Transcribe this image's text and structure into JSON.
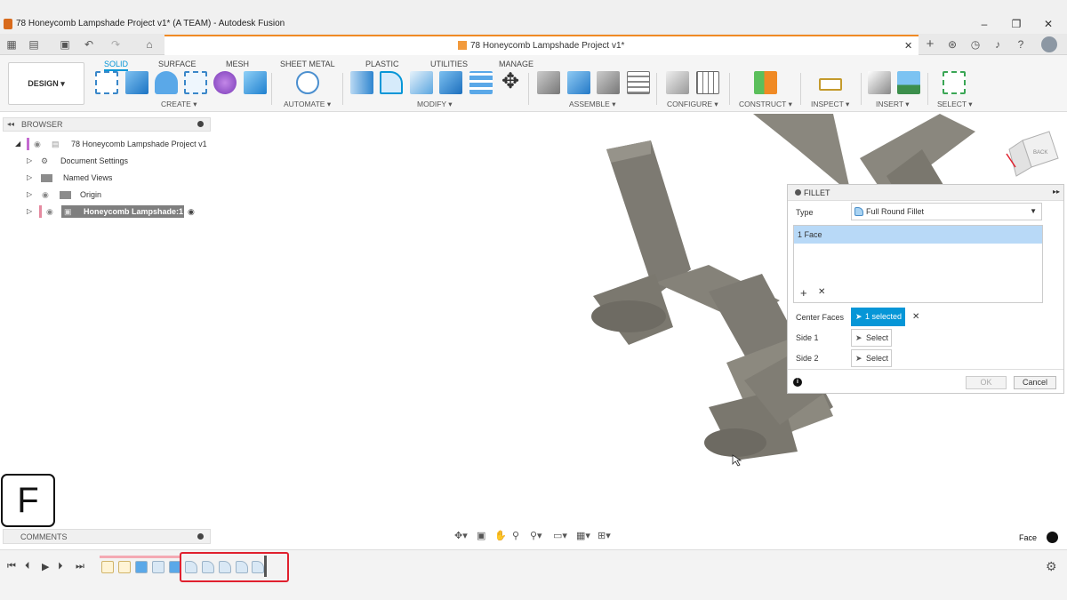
{
  "window": {
    "title": "78 Honeycomb Lampshade Project v1* (A TEAM) - Autodesk Fusion",
    "doc_tab": "78 Honeycomb Lampshade Project v1*"
  },
  "ribbon": {
    "workspace": "DESIGN",
    "tabs": [
      "SOLID",
      "SURFACE",
      "MESH",
      "SHEET METAL",
      "PLASTIC",
      "UTILITIES",
      "MANAGE"
    ],
    "groups": [
      "CREATE",
      "AUTOMATE",
      "MODIFY",
      "ASSEMBLE",
      "CONFIGURE",
      "CONSTRUCT",
      "INSPECT",
      "INSERT",
      "SELECT"
    ]
  },
  "browser": {
    "title": "BROWSER",
    "root": "78 Honeycomb Lampshade Project v1",
    "items": [
      "Document Settings",
      "Named Views",
      "Origin",
      "Honeycomb Lampshade:1"
    ]
  },
  "fillet": {
    "title": "FILLET",
    "type_label": "Type",
    "type_value": "Full Round Fillet",
    "selection_item": "1 Face",
    "center_faces_label": "Center Faces",
    "center_faces_value": "1 selected",
    "side1_label": "Side 1",
    "side1_value": "Select",
    "side2_label": "Side 2",
    "side2_value": "Select",
    "ok": "OK",
    "cancel": "Cancel"
  },
  "comments": {
    "title": "COMMENTS"
  },
  "status": {
    "selection": "Face"
  },
  "viewcube": {
    "face_label": "BACK"
  },
  "overlay": {
    "key": "F"
  },
  "colors": {
    "accent": "#0696d7",
    "model": "#7d7a72",
    "highlight": "#e0202e"
  }
}
